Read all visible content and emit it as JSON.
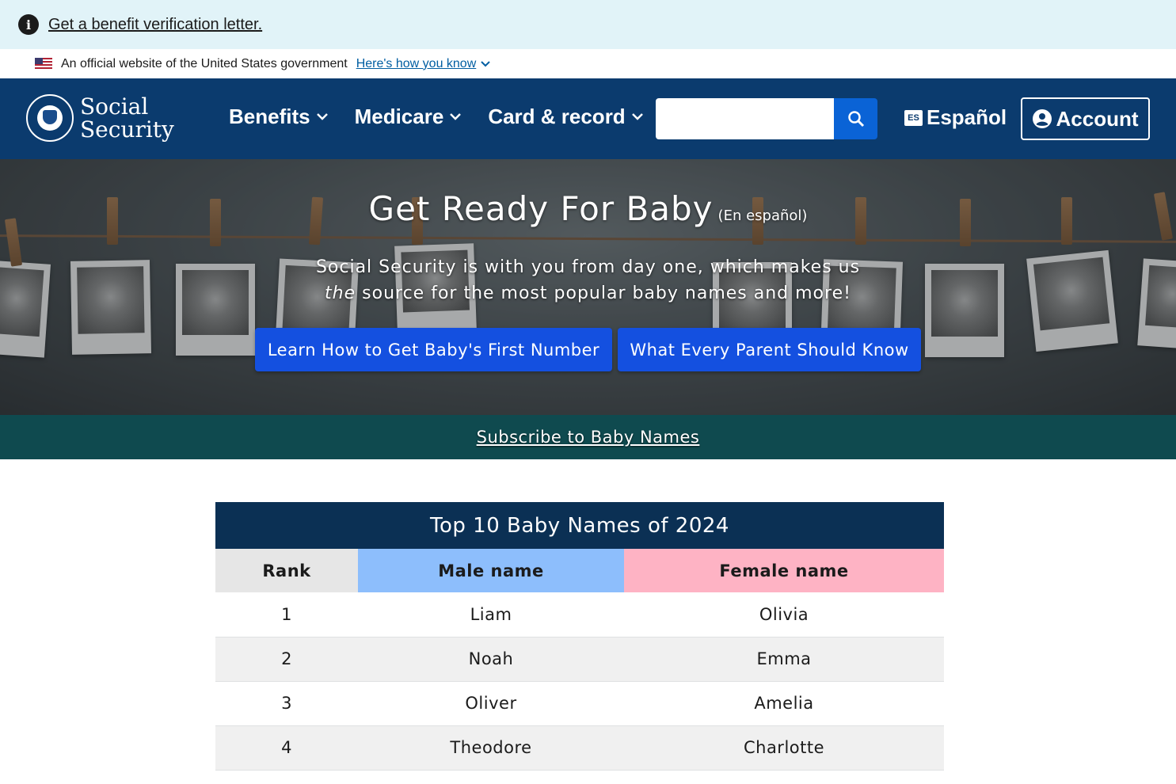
{
  "alert": {
    "link_text": "Get a benefit verification letter."
  },
  "gov_banner": {
    "text": "An official website of the United States government",
    "link_text": "Here's how you know"
  },
  "header": {
    "logo_line1": "Social",
    "logo_line2": "Security",
    "nav": [
      {
        "label": "Benefits"
      },
      {
        "label": "Medicare"
      },
      {
        "label": "Card & record"
      }
    ],
    "search": {
      "placeholder": "",
      "value": ""
    },
    "espanol_badge": "ES",
    "espanol_label": "Español",
    "account_label": "Account",
    "colors": {
      "header_bg": "#0b3b6e",
      "search_button": "#0a63d6"
    }
  },
  "hero": {
    "title": "Get Ready For Baby",
    "title_link": "(En español)",
    "subtitle_line1": "Social Security is with you from day one, which makes us",
    "subtitle_emph": "the",
    "subtitle_line2_rest": " source for the most popular baby names and more!",
    "button1": "Learn How to Get Baby's First Number",
    "button2": "What Every Parent Should Know",
    "colors": {
      "button_bg": "#1450e0"
    }
  },
  "subscribe": {
    "label": "Subscribe to Baby Names",
    "bg": "#0f4a4f"
  },
  "table": {
    "caption": "Top 10 Baby Names of 2024",
    "headers": {
      "rank": "Rank",
      "male": "Male name",
      "female": "Female name"
    },
    "colors": {
      "caption_bg": "#0b3054",
      "rank_header": "#e6e6e6",
      "male_header": "#8dbefc",
      "female_header": "#feb3c4"
    },
    "rows": [
      {
        "rank": "1",
        "male": "Liam",
        "female": "Olivia"
      },
      {
        "rank": "2",
        "male": "Noah",
        "female": "Emma"
      },
      {
        "rank": "3",
        "male": "Oliver",
        "female": "Amelia"
      },
      {
        "rank": "4",
        "male": "Theodore",
        "female": "Charlotte"
      }
    ]
  }
}
